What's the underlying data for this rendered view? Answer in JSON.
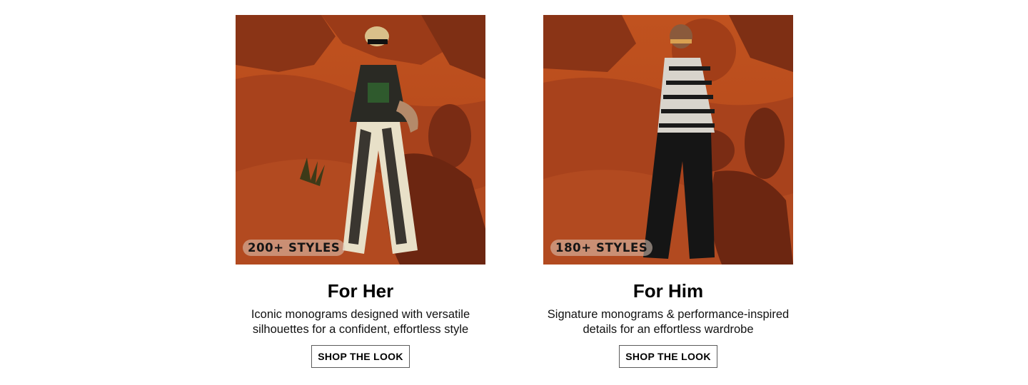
{
  "cards": [
    {
      "badge": "200+ STYLES",
      "title": "For Her",
      "description_line1": "Iconic monograms designed with versatile",
      "description_line2": "silhouettes for a confident, effortless style",
      "cta": "SHOP THE LOOK"
    },
    {
      "badge": "180+ STYLES",
      "title": "For Him",
      "description_line1": "Signature monograms & performance-inspired",
      "description_line2": "details for an effortless wardrobe",
      "cta": "SHOP THE LOOK"
    }
  ],
  "colors": {
    "sky": "#b94a1f",
    "sand": "#a8421c",
    "rock": "#7a2c14",
    "badge_bg": "#dec8ba"
  }
}
